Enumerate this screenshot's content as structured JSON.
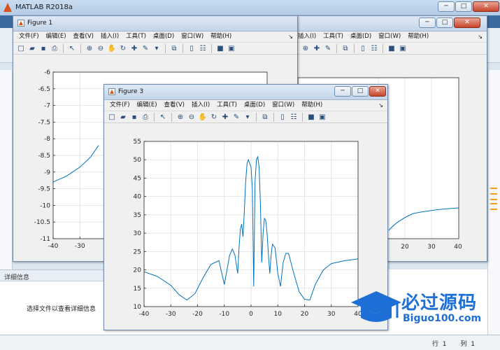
{
  "main_window": {
    "title": "MATLAB R2018a",
    "window_buttons": {
      "minimize": "─",
      "maximize": "□",
      "close": "✕"
    },
    "detail_panel": {
      "header": "详细信息",
      "message": "选择文件以查看详细信息"
    },
    "status": {
      "row_label": "行",
      "row": "1",
      "col_label": "列",
      "col": "1"
    }
  },
  "figure_menu": [
    "文件(F)",
    "编辑(E)",
    "查看(V)",
    "插入(I)",
    "工具(T)",
    "桌面(D)",
    "窗口(W)",
    "帮助(H)"
  ],
  "figure2": {
    "visible_menu": [
      "插入(I)",
      "工具(T)",
      "桌面(D)",
      "窗口(W)",
      "帮助(H)"
    ],
    "visible_xticks": [
      "20",
      "30",
      "40"
    ]
  },
  "figure1": {
    "title": "Figure 1",
    "chart_data": {
      "type": "line",
      "xlim": [
        -40,
        40
      ],
      "ylim": [
        -11,
        -6
      ],
      "visible_xticks": [
        -40,
        -30
      ],
      "yticks": [
        -6,
        -6.5,
        -7,
        -7.5,
        -8,
        -8.5,
        -9,
        -9.5,
        -10,
        -10.5,
        -11
      ],
      "grid": true,
      "series": [
        {
          "color": "#0072BD",
          "x": [
            -40,
            -35,
            -30,
            -26,
            -23
          ],
          "y": [
            -9.3,
            -9.12,
            -8.85,
            -8.55,
            -8.2
          ]
        }
      ]
    }
  },
  "figure3": {
    "title": "Figure 3",
    "chart_data": {
      "type": "line",
      "xlim": [
        -40,
        40
      ],
      "ylim": [
        10,
        55
      ],
      "xticks": [
        -40,
        -30,
        -20,
        -10,
        0,
        10,
        20,
        30,
        40
      ],
      "yticks": [
        10,
        15,
        20,
        25,
        30,
        35,
        40,
        45,
        50,
        55
      ],
      "grid": true,
      "series": [
        {
          "color": "#0072BD",
          "x": [
            -40,
            -35,
            -30,
            -27,
            -24,
            -21,
            -18,
            -15,
            -12,
            -10,
            -9,
            -8,
            -7,
            -6,
            -5,
            -4.5,
            -4,
            -3.5,
            -3,
            -2.5,
            -2,
            -1.5,
            -1,
            -0.5,
            0,
            0.5,
            1,
            1.5,
            2,
            2.5,
            3,
            3.5,
            4,
            4.5,
            5,
            5.5,
            6,
            6.5,
            7,
            7.5,
            8,
            9,
            10,
            11,
            12,
            13,
            14,
            16,
            18,
            20,
            22,
            24,
            27,
            30,
            35,
            40
          ],
          "y": [
            19.5,
            18.2,
            15.8,
            13.3,
            11.8,
            13.5,
            17.8,
            21.5,
            22.5,
            16.0,
            20.0,
            24.0,
            25.7,
            24.0,
            19.0,
            26.0,
            31.0,
            32.5,
            29.0,
            36.0,
            44.0,
            49.0,
            50.0,
            49.0,
            48.0,
            42.0,
            15.5,
            44.0,
            50.0,
            50.8,
            48.0,
            38.0,
            22.0,
            30.0,
            34.0,
            33.5,
            30.0,
            24.0,
            19.0,
            24.0,
            27.0,
            26.0,
            19.0,
            15.5,
            22.0,
            24.5,
            24.5,
            19.0,
            14.0,
            12.0,
            11.8,
            16.0,
            20.0,
            21.7,
            22.5,
            23.0
          ]
        }
      ]
    }
  },
  "watermark": {
    "text": "必过源码",
    "sub": "Biguo100.com"
  }
}
